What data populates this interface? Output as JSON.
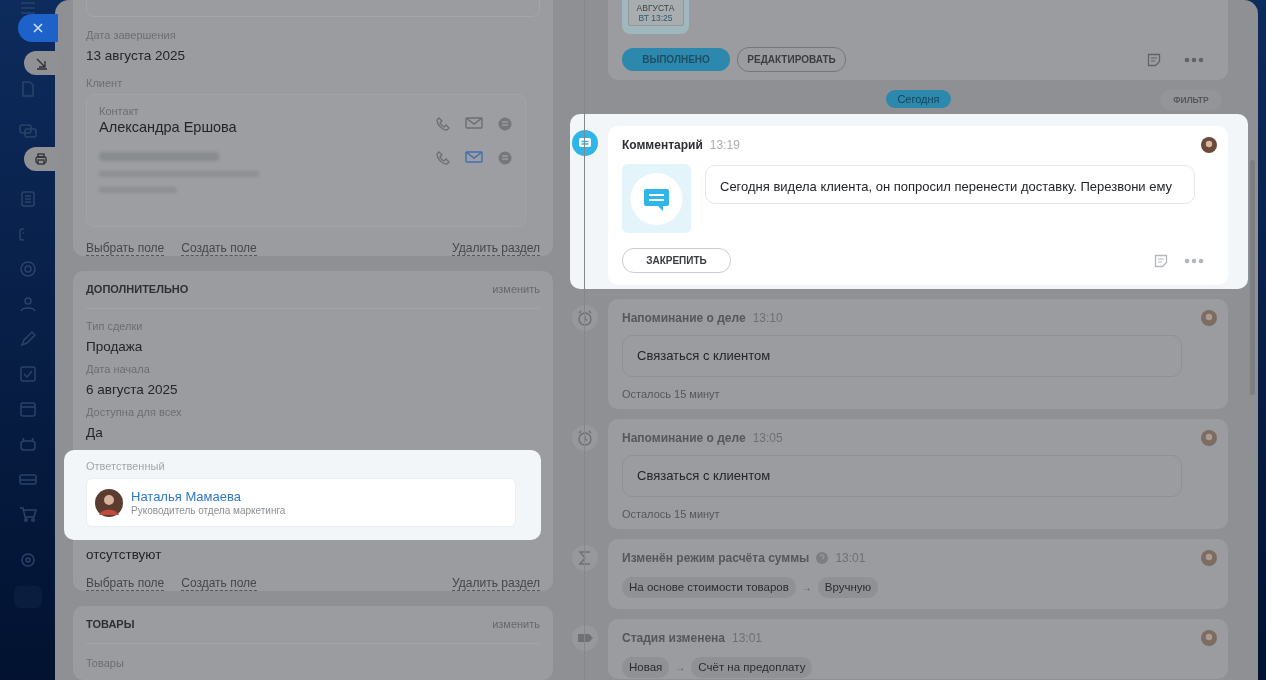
{
  "previous_activity": {
    "date_month": "АВГУСТА",
    "date_time": "ВТ 13:25",
    "buttons": [
      {
        "label": "ВЫПОЛНЕНО",
        "kind": "primary"
      },
      {
        "label": "РЕДАКТИРОВАТЬ",
        "kind": "outline"
      }
    ]
  },
  "main_section": {
    "fields": [
      {
        "label": "Дата завершения",
        "value": "13 августа 2025"
      }
    ],
    "client_label": "Клиент",
    "contact_label": "Контакт",
    "contact_name": "Александра Ершова",
    "contact_rows": [
      {
        "email_active": false
      },
      {
        "email_active": true
      }
    ],
    "links": [
      "Выбрать поле",
      "Создать поле"
    ],
    "delete_link": "Удалить раздел"
  },
  "additional_section": {
    "title": "ДОПОЛНИТЕЛЬНО",
    "edit_link": "изменить",
    "fields": [
      {
        "label": "Тип сделки",
        "value": "Продажа"
      },
      {
        "label": "Дата начала",
        "value": "6 августа 2025"
      },
      {
        "label": "Доступна для всех",
        "value": "Да"
      }
    ],
    "responsible": {
      "label": "Ответственный",
      "name": "Наталья Мамаева",
      "position": "Руководитель отдела маркетинга",
      "highlighted": true
    },
    "tags_value": "отсутствуют",
    "links": [
      "Выбрать поле",
      "Создать поле"
    ],
    "delete_link": "Удалить раздел"
  },
  "products_section": {
    "title": "ТОВАРЫ",
    "edit_link": "изменить",
    "field_label": "Товары"
  },
  "timeline": {
    "today": "Сегодня",
    "filter": "ФИЛЬТР",
    "items": [
      {
        "kind": "comment",
        "title": "Комментарий",
        "time": "13:19",
        "text": "Сегодня видела клиента, он попросил перенести доставку. Перезвони ему",
        "button": "ЗАКРЕПИТЬ",
        "highlighted": true
      },
      {
        "kind": "reminder",
        "title": "Напоминание о деле",
        "time": "13:10",
        "text": "Связаться с клиентом",
        "footer": "Осталось 15 минут",
        "highlighted": false
      },
      {
        "kind": "reminder",
        "title": "Напоминание о деле",
        "time": "13:05",
        "text": "Связаться с клиентом",
        "footer": "Осталось 15 минут",
        "highlighted": false
      },
      {
        "kind": "sum_mode",
        "title": "Изменён режим расчёта суммы",
        "time": "13:01",
        "from": "На основе стоимости товаров",
        "arrow": "→",
        "to": "Вручную",
        "highlighted": false
      },
      {
        "kind": "stage",
        "title": "Стадия изменена",
        "time": "13:01",
        "from": "Новая",
        "arrow": "→",
        "to": "Счёт на предоплату",
        "highlighted": false
      }
    ]
  }
}
